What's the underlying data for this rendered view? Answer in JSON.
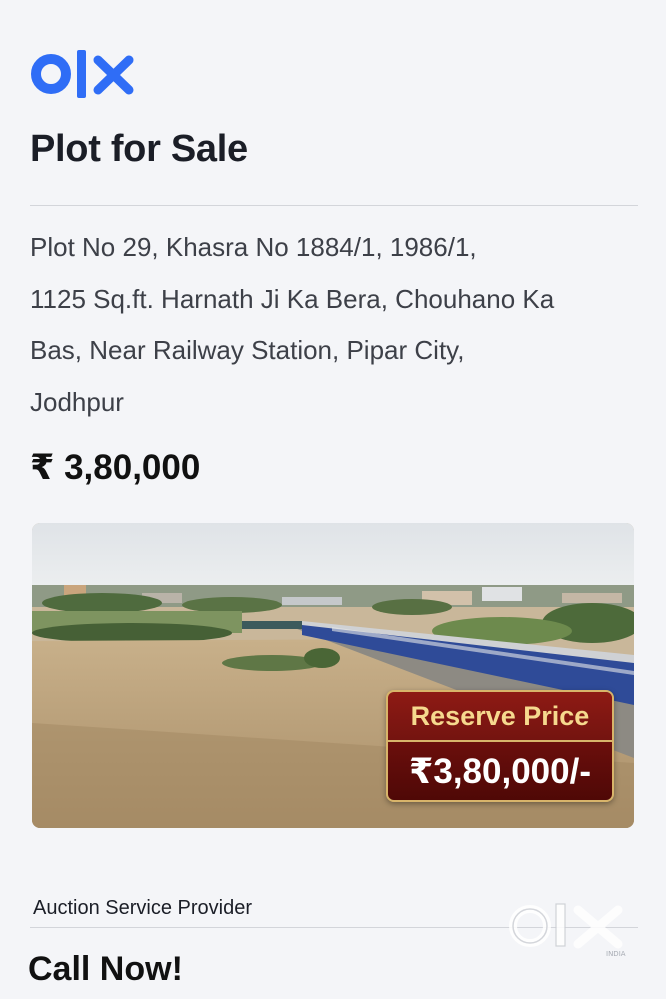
{
  "brand": {
    "name": "OLX",
    "color": "#2f6df6"
  },
  "listing": {
    "title": "Plot for Sale",
    "address_lines": [
      "Plot No 29, Khasra No 1884/1, 1986/1,",
      "1125 Sq.ft. Harnath Ji Ka Bera, Chouhano Ka",
      "Bas, Near Railway Station, Pipar City,",
      "Jodhpur"
    ],
    "price": "₹ 3,80,000"
  },
  "photo": {
    "badge": {
      "label": "Reserve Price",
      "value": "₹3,80,000/-"
    }
  },
  "footer": {
    "provider_label": "Auction Service Provider",
    "cta": "Call Now!"
  },
  "watermark": {
    "sub": "INDIA"
  }
}
